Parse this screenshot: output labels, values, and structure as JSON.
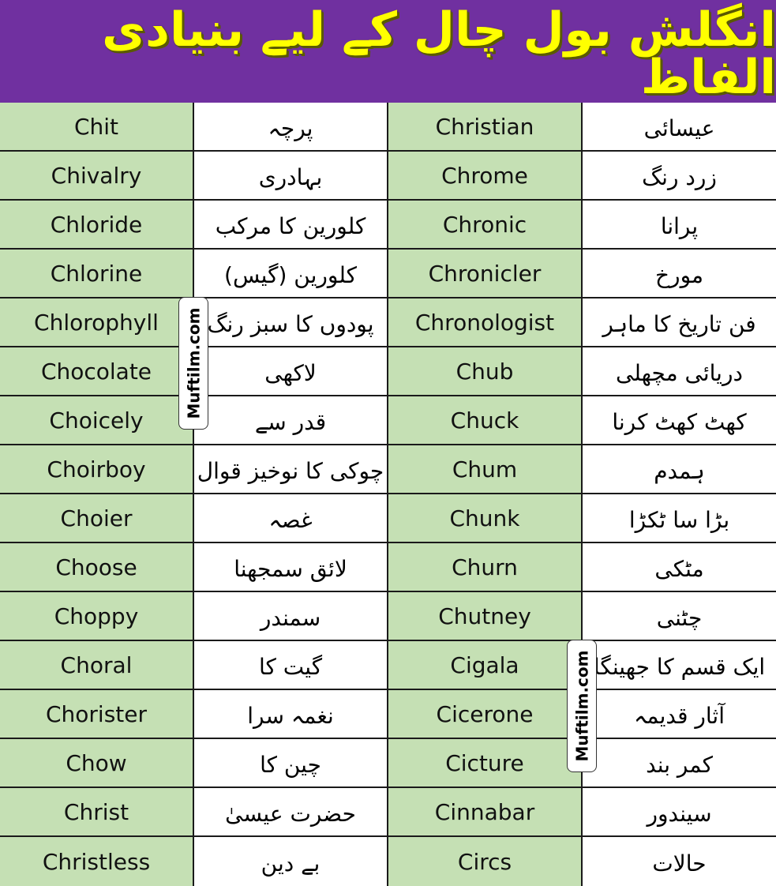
{
  "header": {
    "title": "انگلش بول چال کے لیے بنیادی الفاظ",
    "background_color": "#7030a0",
    "title_color": "#ffff00"
  },
  "colors": {
    "english_cell": "#c5e0b4",
    "urdu_cell": "#ffffff",
    "border": "#1a1a1a"
  },
  "watermark": "Muftilm.com",
  "rows": [
    {
      "en1": "Chit",
      "ur1": "پرچہ",
      "en2": "Christian",
      "ur2": "عیسائی"
    },
    {
      "en1": "Chivalry",
      "ur1": "بہادری",
      "en2": "Chrome",
      "ur2": "زرد رنگ"
    },
    {
      "en1": "Chloride",
      "ur1": "کلورین کا مرکب",
      "en2": "Chronic",
      "ur2": "پرانا"
    },
    {
      "en1": "Chlorine",
      "ur1": "کلورین (گیس)",
      "en2": "Chronicler",
      "ur2": "مورخ"
    },
    {
      "en1": "Chlorophyll",
      "ur1": "پودوں کا سبز رنگ",
      "en2": "Chronologist",
      "ur2": "فن تاریخ کا ماہر"
    },
    {
      "en1": "Chocolate",
      "ur1": "لاکھی",
      "en2": "Chub",
      "ur2": "دریائی مچھلی"
    },
    {
      "en1": "Choicely",
      "ur1": "قدر سے",
      "en2": "Chuck",
      "ur2": "کھٹ کھٹ کرنا"
    },
    {
      "en1": "Choirboy",
      "ur1": "چوکی کا نوخیز قوال",
      "en2": "Chum",
      "ur2": "ہمدم"
    },
    {
      "en1": "Choier",
      "ur1": "غصہ",
      "en2": "Chunk",
      "ur2": "بڑا سا ٹکڑا"
    },
    {
      "en1": "Choose",
      "ur1": "لائق سمجھنا",
      "en2": "Churn",
      "ur2": "مٹکی"
    },
    {
      "en1": "Choppy",
      "ur1": "سمندر",
      "en2": "Chutney",
      "ur2": "چٹنی"
    },
    {
      "en1": "Choral",
      "ur1": "گیت کا",
      "en2": "Cigala",
      "ur2": "ایک قسم کا جھینگا"
    },
    {
      "en1": "Chorister",
      "ur1": "نغمہ سرا",
      "en2": "Cicerone",
      "ur2": "آثار قدیمہ"
    },
    {
      "en1": "Chow",
      "ur1": "چین کا",
      "en2": "Cicture",
      "ur2": "کمر بند"
    },
    {
      "en1": "Christ",
      "ur1": "حضرت عیسیٰ",
      "en2": "Cinnabar",
      "ur2": "سیندور"
    },
    {
      "en1": "Christless",
      "ur1": "بے دین",
      "en2": "Circs",
      "ur2": "حالات"
    }
  ]
}
